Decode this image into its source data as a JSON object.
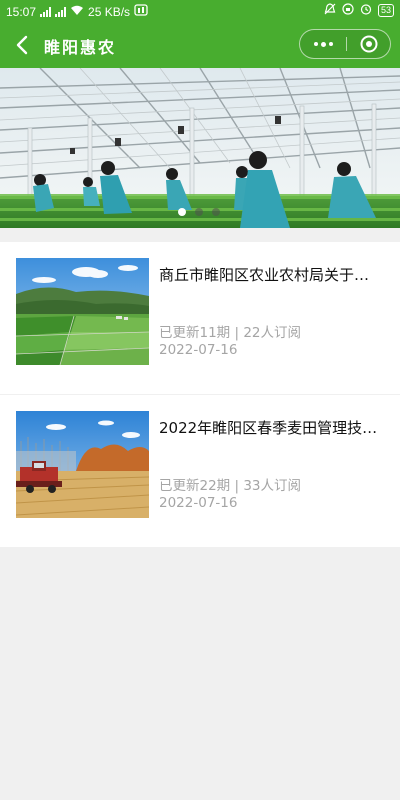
{
  "status_bar": {
    "time": "15:07",
    "network_speed": "25 KB/s",
    "battery": "53"
  },
  "header": {
    "title": "睢阳惠农",
    "bg_color": "#48ad2f"
  },
  "banner": {
    "slide_count": 3,
    "active_index": 0
  },
  "articles": [
    {
      "title": "商丘市睢阳区农业农村局关于…",
      "updates": "已更新11期",
      "subscribers": "22人订阅",
      "date": "2022-07-16",
      "thumb": "aerial-farmland-image"
    },
    {
      "title": "2022年睢阳区春季麦田管理技…",
      "updates": "已更新22期",
      "subscribers": "33人订阅",
      "date": "2022-07-16",
      "thumb": "harvester-wheat-field-image"
    }
  ]
}
